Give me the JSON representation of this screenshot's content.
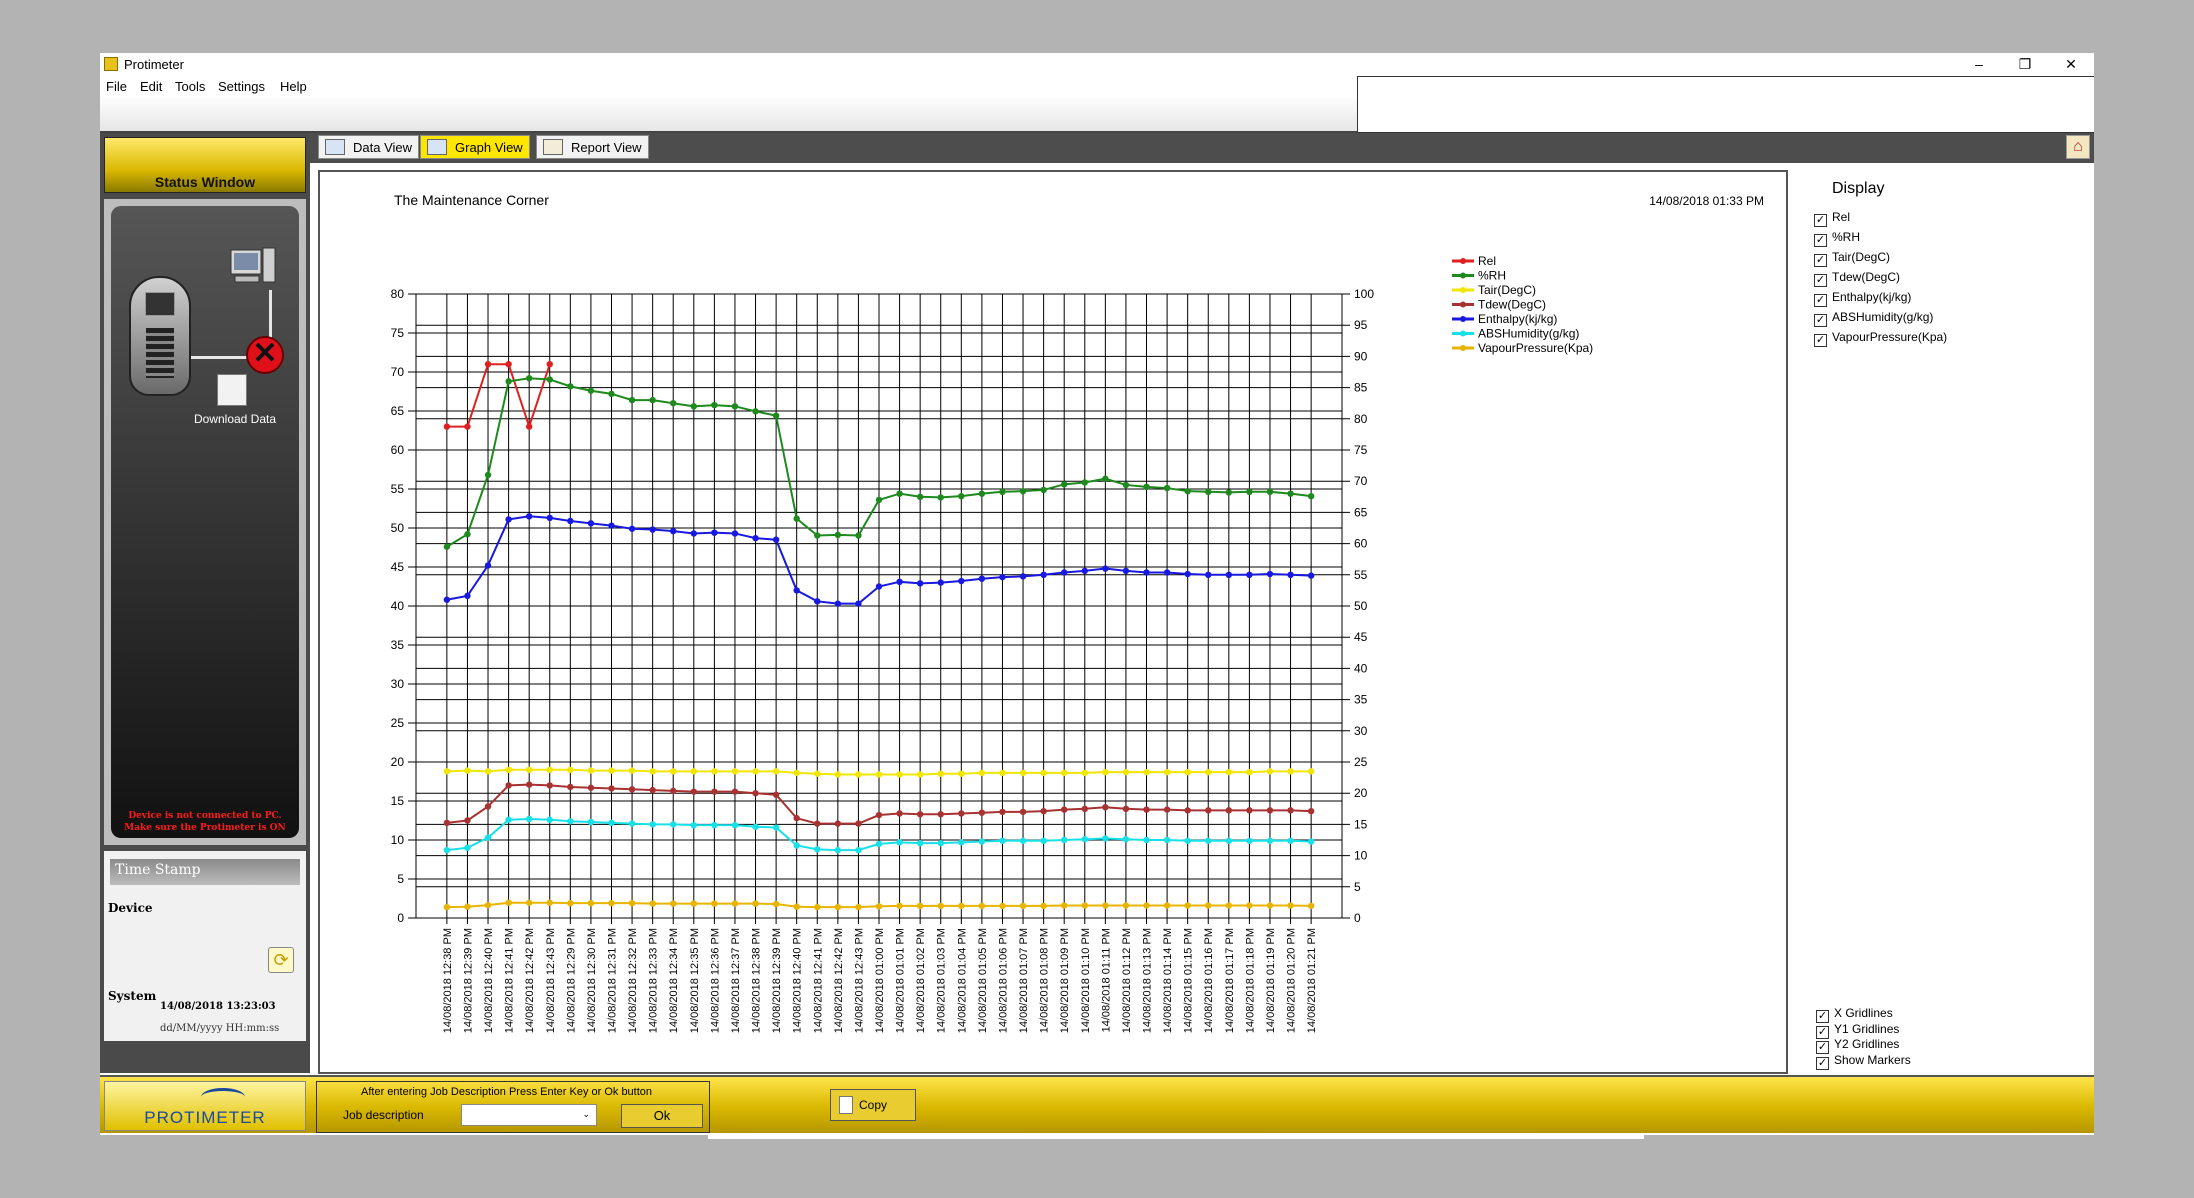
{
  "window": {
    "title": "Protimeter",
    "min": "–",
    "restore": "❐",
    "close": "✕"
  },
  "menu": [
    "File",
    "Edit",
    "Tools",
    "Settings",
    "Help"
  ],
  "tabs": [
    {
      "label": "Data View",
      "active": false
    },
    {
      "label": "Graph View",
      "active": true
    },
    {
      "label": "Report View",
      "active": false
    }
  ],
  "status": {
    "title": "Status Window",
    "download_label": "Download Data",
    "warning_line1": "Device is not connected to PC.",
    "warning_line2": "Make sure the Protimeter is ON"
  },
  "timestamp": {
    "header": "Time Stamp",
    "device_label": "Device",
    "system_label": "System",
    "system_value": "14/08/2018  13:23:03",
    "format_hint": "dd/MM/yyyy  HH:mm:ss"
  },
  "graph": {
    "company": "The Maintenance Corner",
    "datetime": "14/08/2018 01:33 PM"
  },
  "display": {
    "title": "Display",
    "series_toggles": [
      "Rel",
      "%RH",
      "Tair(DegC)",
      "Tdew(DegC)",
      "Enthalpy(kj/kg)",
      "ABSHumidity(g/kg)",
      "VapourPressure(Kpa)"
    ],
    "grid_toggles": [
      "X Gridlines",
      "Y1 Gridlines",
      "Y2 Gridlines",
      "Show Markers"
    ]
  },
  "bottom": {
    "logo": "PROTIMETER",
    "job_instruction": "After entering Job Description Press Enter Key or Ok button",
    "job_label": "Job description",
    "job_value": "",
    "ok_label": "Ok",
    "copy_label": "Copy"
  },
  "chart_data": {
    "type": "line",
    "y1lim": [
      0,
      80
    ],
    "y2lim": [
      0,
      100
    ],
    "y1ticks": [
      0,
      5,
      10,
      15,
      20,
      25,
      30,
      35,
      40,
      45,
      50,
      55,
      60,
      65,
      70,
      75,
      80
    ],
    "y2ticks": [
      0,
      5,
      10,
      15,
      20,
      25,
      30,
      35,
      40,
      45,
      50,
      55,
      60,
      65,
      70,
      75,
      80,
      85,
      90,
      95,
      100
    ],
    "x": [
      "14/08/2018 12:38 PM",
      "14/08/2018 12:39 PM",
      "14/08/2018 12:40 PM",
      "14/08/2018 12:41 PM",
      "14/08/2018 12:42 PM",
      "14/08/2018 12:43 PM",
      "14/08/2018 12:29 PM",
      "14/08/2018 12:30 PM",
      "14/08/2018 12:31 PM",
      "14/08/2018 12:32 PM",
      "14/08/2018 12:33 PM",
      "14/08/2018 12:34 PM",
      "14/08/2018 12:35 PM",
      "14/08/2018 12:36 PM",
      "14/08/2018 12:37 PM",
      "14/08/2018 12:38 PM",
      "14/08/2018 12:39 PM",
      "14/08/2018 12:40 PM",
      "14/08/2018 12:41 PM",
      "14/08/2018 12:42 PM",
      "14/08/2018 12:43 PM",
      "14/08/2018 01:00 PM",
      "14/08/2018 01:01 PM",
      "14/08/2018 01:02 PM",
      "14/08/2018 01:03 PM",
      "14/08/2018 01:04 PM",
      "14/08/2018 01:05 PM",
      "14/08/2018 01:06 PM",
      "14/08/2018 01:07 PM",
      "14/08/2018 01:08 PM",
      "14/08/2018 01:09 PM",
      "14/08/2018 01:10 PM",
      "14/08/2018 01:11 PM",
      "14/08/2018 01:12 PM",
      "14/08/2018 01:13 PM",
      "14/08/2018 01:14 PM",
      "14/08/2018 01:15 PM",
      "14/08/2018 01:16 PM",
      "14/08/2018 01:17 PM",
      "14/08/2018 01:18 PM",
      "14/08/2018 01:19 PM",
      "14/08/2018 01:20 PM",
      "14/08/2018 01:21 PM"
    ],
    "grid": true,
    "legend": "top-right",
    "series": [
      {
        "name": "Rel",
        "color": "#e02020",
        "axis": "y1",
        "values": [
          63,
          63,
          71,
          71,
          63,
          71
        ]
      },
      {
        "name": "%RH",
        "color": "#1e8a1e",
        "axis": "y2",
        "values": [
          59.5,
          61.5,
          71,
          86,
          86.5,
          86.3,
          85.2,
          84.5,
          84,
          83,
          83,
          82.5,
          82,
          82.2,
          82,
          81.2,
          80.5,
          64,
          61.3,
          61.4,
          61.3,
          67,
          68,
          67.5,
          67.4,
          67.6,
          68,
          68.3,
          68.4,
          68.6,
          69.5,
          69.8,
          70.4,
          69.4,
          69.1,
          68.9,
          68.4,
          68.3,
          68.2,
          68.3,
          68.3,
          68,
          67.6
        ]
      },
      {
        "name": "Tair(DegC)",
        "color": "#f0e600",
        "axis": "y1",
        "values": [
          18.8,
          18.9,
          18.8,
          19,
          19,
          19,
          19,
          18.9,
          18.9,
          18.9,
          18.8,
          18.8,
          18.8,
          18.8,
          18.8,
          18.8,
          18.8,
          18.6,
          18.5,
          18.4,
          18.4,
          18.4,
          18.4,
          18.4,
          18.5,
          18.5,
          18.6,
          18.6,
          18.6,
          18.6,
          18.6,
          18.6,
          18.7,
          18.7,
          18.7,
          18.7,
          18.7,
          18.7,
          18.7,
          18.7,
          18.8,
          18.8,
          18.8
        ]
      },
      {
        "name": "Tdew(DegC)",
        "color": "#a83232",
        "axis": "y1",
        "values": [
          12.2,
          12.5,
          14.3,
          17,
          17.1,
          17,
          16.8,
          16.7,
          16.6,
          16.5,
          16.4,
          16.3,
          16.2,
          16.2,
          16.2,
          16,
          15.8,
          12.8,
          12.1,
          12.1,
          12.1,
          13.2,
          13.4,
          13.3,
          13.3,
          13.4,
          13.5,
          13.6,
          13.6,
          13.7,
          13.9,
          14,
          14.2,
          14,
          13.9,
          13.9,
          13.8,
          13.8,
          13.8,
          13.8,
          13.8,
          13.8,
          13.7
        ]
      },
      {
        "name": "Enthalpy(kj/kg)",
        "color": "#1818e0",
        "axis": "y1",
        "values": [
          40.8,
          41.3,
          45.2,
          51.1,
          51.5,
          51.3,
          50.9,
          50.6,
          50.3,
          49.9,
          49.8,
          49.6,
          49.3,
          49.4,
          49.3,
          48.7,
          48.5,
          42,
          40.6,
          40.3,
          40.3,
          42.5,
          43.1,
          42.9,
          43,
          43.2,
          43.5,
          43.7,
          43.8,
          44,
          44.3,
          44.5,
          44.8,
          44.5,
          44.3,
          44.3,
          44.1,
          44,
          44,
          44,
          44.1,
          44,
          43.9
        ]
      },
      {
        "name": "ABSHumidity(g/kg)",
        "color": "#18e0e8",
        "axis": "y1",
        "values": [
          8.7,
          9,
          10.3,
          12.6,
          12.7,
          12.6,
          12.4,
          12.3,
          12.2,
          12.1,
          12,
          12,
          11.9,
          11.9,
          11.9,
          11.7,
          11.6,
          9.3,
          8.8,
          8.7,
          8.7,
          9.5,
          9.7,
          9.6,
          9.6,
          9.7,
          9.8,
          9.9,
          9.9,
          9.9,
          10,
          10.1,
          10.2,
          10.1,
          10,
          10,
          9.9,
          9.9,
          9.9,
          9.9,
          9.9,
          9.9,
          9.8
        ]
      },
      {
        "name": "VapourPressure(Kpa)",
        "color": "#e8b400",
        "axis": "y1",
        "values": [
          1.4,
          1.45,
          1.65,
          1.95,
          1.95,
          1.95,
          1.9,
          1.9,
          1.9,
          1.9,
          1.85,
          1.85,
          1.85,
          1.85,
          1.85,
          1.85,
          1.8,
          1.45,
          1.4,
          1.4,
          1.4,
          1.5,
          1.55,
          1.55,
          1.55,
          1.55,
          1.55,
          1.55,
          1.55,
          1.55,
          1.6,
          1.6,
          1.6,
          1.6,
          1.6,
          1.6,
          1.6,
          1.6,
          1.6,
          1.6,
          1.6,
          1.6,
          1.55
        ]
      }
    ]
  }
}
